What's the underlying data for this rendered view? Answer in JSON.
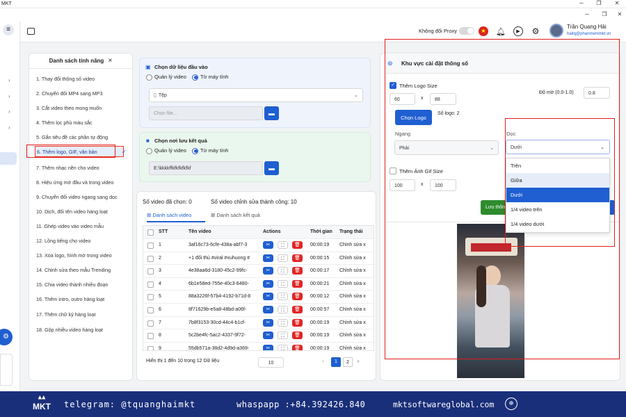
{
  "window": {
    "title": "MKT",
    "min": "─",
    "restore": "❐",
    "close": "✕"
  },
  "header": {
    "proxy_label": "Không đổi Proxy",
    "user_name": "Trần Quang Hải",
    "user_email": "haitq@phanmemmkt.vn"
  },
  "features": {
    "title": "Danh sách tính năng",
    "close": "×",
    "items": [
      "1.  Thay đổi thông số video",
      "2.  Chuyển đổi MP4 sang MP3",
      "3.  Cắt video theo mong muốn",
      "4.  Thêm lọc phủ màu sắc",
      "5.  Gắn tiêu đề các phần tự động",
      "6.  Thêm logo, GIF, văn bản",
      "7.  Thêm nhạc nền cho video",
      "8.  Hiệu ứng mở đầu và trong video",
      "9.  Chuyển đổi video ngang sang dọc",
      "10. Dịch, đổi tên video hàng loạt",
      "11. Ghép video vào video mẫu",
      "12. Lồng tiếng cho video",
      "13. Xóa logo, hình mờ trong video",
      "14. Chỉnh sửa theo mẫu Trending",
      "15. Chia video thành nhiều đoạn",
      "16. Thêm intro, outro hàng loạt",
      "17. Thêm chữ ký hàng loạt",
      "18. Gộp nhiều video hàng loạt"
    ],
    "active_index": 5
  },
  "input": {
    "title": "Chọn dữ liệu đầu vào",
    "opt1": "Quản lý video",
    "opt2": "Từ máy tính",
    "type_value": "Tệp",
    "file_placeholder": "Chọn file..."
  },
  "output": {
    "title": "Chọn nơi lưu kết quả",
    "opt1": "Quản lý video",
    "opt2": "Từ máy tính",
    "path": "E:\\kkkkffkfkfkfkfkf"
  },
  "results": {
    "selected": "Số video đã chọn: 0",
    "success": "Số video chỉnh sửa thành công: 10",
    "tab1": "Danh sách video",
    "tab2": "Danh sách kết quả",
    "columns": [
      "STT",
      "Tên video",
      "Actions",
      "Thời gian",
      "Trạng thái"
    ],
    "rows": [
      [
        "1",
        "3af16c73-6cfe-438a-abf7-3",
        "00:00:19",
        "Chỉnh sửa x"
      ],
      [
        "2",
        "+1 đối thủ #viral #xuhuong #",
        "00:00:15",
        "Chỉnh sửa x"
      ],
      [
        "3",
        "4e38aa6d-3180-45c2-99fc-",
        "00:00:17",
        "Chỉnh sửa x"
      ],
      [
        "4",
        "6b1e58ed-755e-40c3-8480-",
        "00:00:21",
        "Chỉnh sửa x"
      ],
      [
        "5",
        "88a3226f-57b4-4192-b71d-8",
        "00:00:12",
        "Chỉnh sửa x"
      ],
      [
        "6",
        "8f71629b-e5a8-48bd-a06f-",
        "00:00:57",
        "Chỉnh sửa x"
      ],
      [
        "7",
        "7b8f3153-30cd-44c4-b1cf-",
        "00:00:19",
        "Chỉnh sửa x"
      ],
      [
        "8",
        "5c2be4fc-5ac2-4337-9f72-",
        "00:00:19",
        "Chỉnh sửa x"
      ],
      [
        "9",
        "55db571a-38d2-4d9d-a369-",
        "00:00:19",
        "Chỉnh sửa x"
      ]
    ],
    "footer_text": "Hiển thị 1 đến 10 trong 12 Dữ liệu",
    "page_size": "10",
    "pages": [
      "‹",
      "1",
      "2",
      "›"
    ]
  },
  "settings": {
    "title": "Khu vực cài đặt thông số",
    "logo_size_label": "Thêm Logo Size",
    "logo_w": "60",
    "logo_x": "x",
    "logo_h": "88",
    "opacity_label": "Độ mờ (0.0-1.0)",
    "opacity": "0.8",
    "choose_logo": "Chọn Logo",
    "logo_count": "Số logo: 2",
    "horizontal_label": "Ngang",
    "horizontal_value": "Phải",
    "vertical_label": "Dọc",
    "vertical_value": "Dưới",
    "gif_label": "Thêm Ảnh Gif Size",
    "gif_w": "100",
    "gif_x": "x",
    "gif_h": "100",
    "save_label": "Lưu thôn",
    "dropdown": [
      "Trên",
      "Giữa",
      "Dưới",
      "1/4 video trên",
      "1/4 video dưới"
    ],
    "dropdown_selected": 2,
    "dropdown_hover": 1
  },
  "footer": {
    "telegram": "telegram: @tquanghaimkt",
    "whatsapp": "whaspapp :+84.392426.840",
    "site": "mktsoftwareglobal.com",
    "logo": "MKT"
  }
}
